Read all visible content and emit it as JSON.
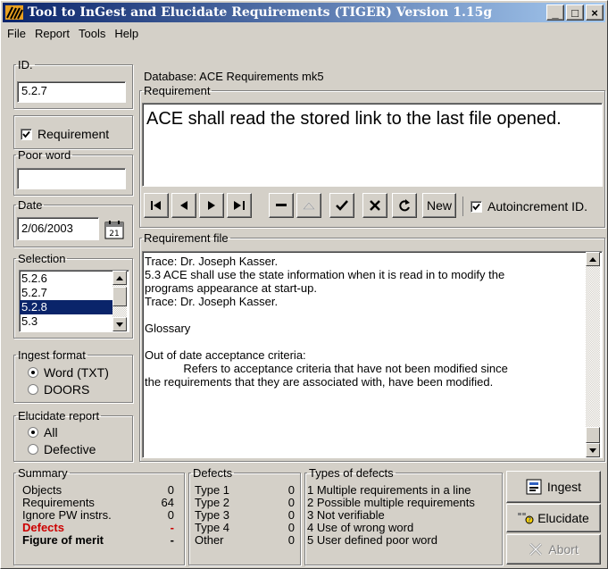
{
  "window": {
    "title": "Tool to InGest and Elucidate Requirements (TIGER) Version 1.15g",
    "minimize": "_",
    "maximize": "□",
    "close": "×"
  },
  "menu": [
    "File",
    "Report",
    "Tools",
    "Help"
  ],
  "id": {
    "label": "ID.",
    "value": "5.2.7"
  },
  "requirement_check": {
    "label": "Requirement",
    "checked": true
  },
  "poor_word": {
    "label": "Poor word",
    "value": ""
  },
  "date": {
    "label": "Date",
    "value": "2/06/2003"
  },
  "selection": {
    "label": "Selection",
    "items": [
      "5.2.6",
      "5.2.7",
      "5.2.8",
      "5.3"
    ],
    "selected": "5.2.8"
  },
  "ingest_format": {
    "label": "Ingest format",
    "options": [
      "Word (TXT)",
      "DOORS"
    ],
    "selected": "Word (TXT)"
  },
  "elucidate_report": {
    "label": "Elucidate report",
    "options": [
      "All",
      "Defective"
    ],
    "selected": "All"
  },
  "database": "Database: ACE Requirements mk5",
  "requirement": {
    "label": "Requirement",
    "text": "ACE shall read the stored link to the last file opened."
  },
  "nav": {
    "first_icon": "first-record-icon",
    "new_label": "New",
    "autoincrement_label": "Autoincrement ID.",
    "autoincrement_checked": true
  },
  "requirement_file": {
    "label": "Requirement file",
    "lines": [
      "Trace: Dr. Joseph Kasser.",
      "5.3 ACE shall use the state information when it is read in to modify the",
      "programs appearance at start-up.",
      "Trace: Dr. Joseph Kasser.",
      "",
      "Glossary",
      "",
      "Out of date acceptance criteria:",
      "            Refers to acceptance criteria that have not been modified since",
      "the requirements that they are associated with, have been modified."
    ]
  },
  "summary": {
    "label": "Summary",
    "rows": [
      {
        "name": "Objects",
        "value": "0"
      },
      {
        "name": "Requirements",
        "value": "64"
      },
      {
        "name": "Ignore PW instrs.",
        "value": "0"
      },
      {
        "name": "Defects",
        "value": "-"
      },
      {
        "name": "Figure of merit",
        "value": "-"
      }
    ]
  },
  "defects": {
    "label": "Defects",
    "rows": [
      {
        "name": "Type 1",
        "value": "0"
      },
      {
        "name": "Type 2",
        "value": "0"
      },
      {
        "name": "Type 3",
        "value": "0"
      },
      {
        "name": "Type 4",
        "value": "0"
      },
      {
        "name": "Other",
        "value": "0"
      }
    ]
  },
  "types_of_defects": {
    "label": "Types of defects",
    "items": [
      "1 Multiple requirements in a line",
      "2 Possible multiple requirements",
      "3 Not verifiable",
      "4 Use of wrong word",
      "5 User defined poor word"
    ]
  },
  "buttons": {
    "ingest": "Ingest",
    "elucidate": "Elucidate",
    "abort": "Abort"
  },
  "colors": {
    "title_start": "#0a246a",
    "title_end": "#a6caf0",
    "defects_red": "#cc0000",
    "selection": "#0a246a"
  }
}
